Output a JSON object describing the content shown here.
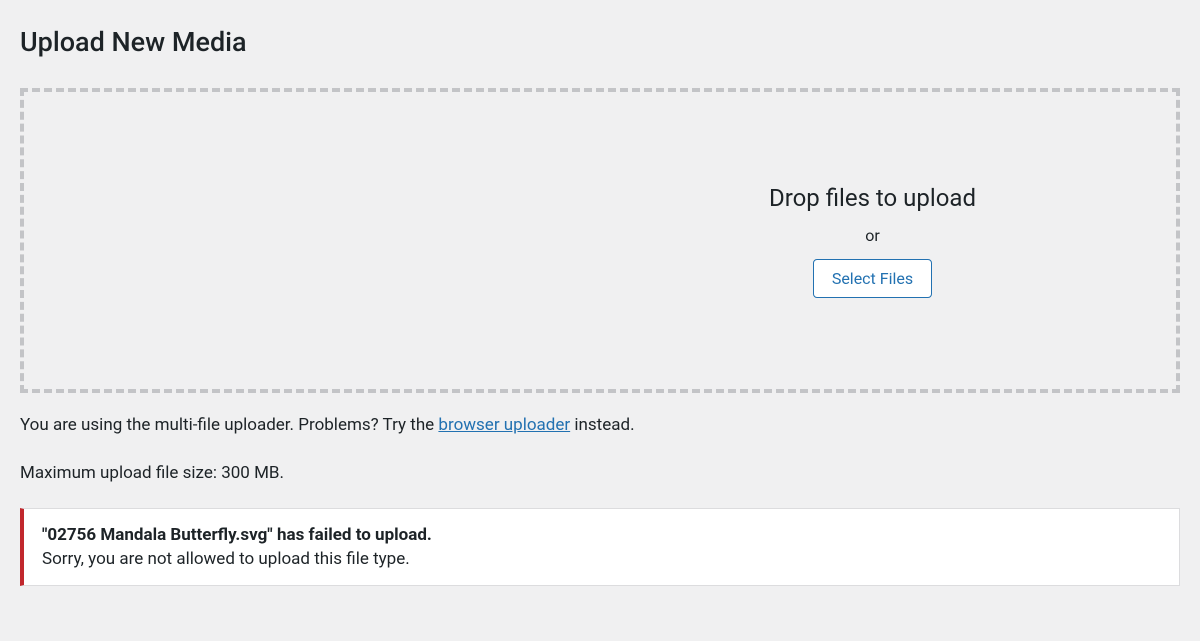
{
  "page_title": "Upload New Media",
  "dropzone": {
    "drop_text": "Drop files to upload",
    "or_text": "or",
    "select_button": "Select Files"
  },
  "uploader_info": {
    "prefix": "You are using the multi-file uploader. Problems? Try the ",
    "link_text": "browser uploader",
    "suffix": " instead."
  },
  "max_size_text": "Maximum upload file size: 300 MB.",
  "error": {
    "filename": "\"02756 Mandala Butterfly.svg\"",
    "failed_suffix": " has failed to upload.",
    "message": "Sorry, you are not allowed to upload this file type."
  }
}
